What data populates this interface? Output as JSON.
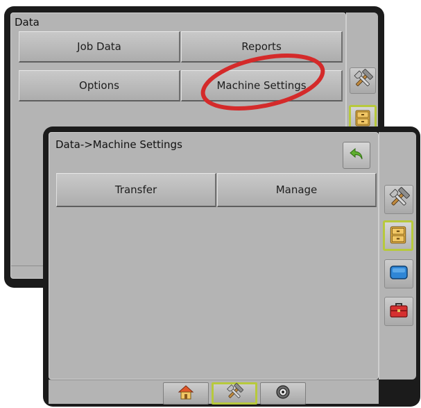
{
  "back_screen": {
    "title": "Data",
    "buttons": {
      "job_data": "Job Data",
      "reports": "Reports",
      "options": "Options",
      "machine_settings": "Machine Settings"
    },
    "side_tabs": [
      "tools-icon",
      "file-cabinet-icon"
    ]
  },
  "front_screen": {
    "breadcrumb": "Data->Machine Settings",
    "buttons": {
      "transfer": "Transfer",
      "manage": "Manage"
    },
    "side_tabs": [
      "tools-icon",
      "file-cabinet-icon",
      "monitor-icon",
      "toolbox-icon"
    ],
    "bottom_tabs": [
      "home-icon",
      "tools-icon",
      "gauge-icon"
    ],
    "active_side_tab": "file-cabinet-icon",
    "active_bottom_tab": "tools-icon"
  },
  "colors": {
    "highlight_oval": "#d42a2a",
    "active_outline": "#b7c93c",
    "back_arrow": "#5fae2f",
    "panel": "#b4b4b4",
    "bezel": "#1b1b1b"
  }
}
